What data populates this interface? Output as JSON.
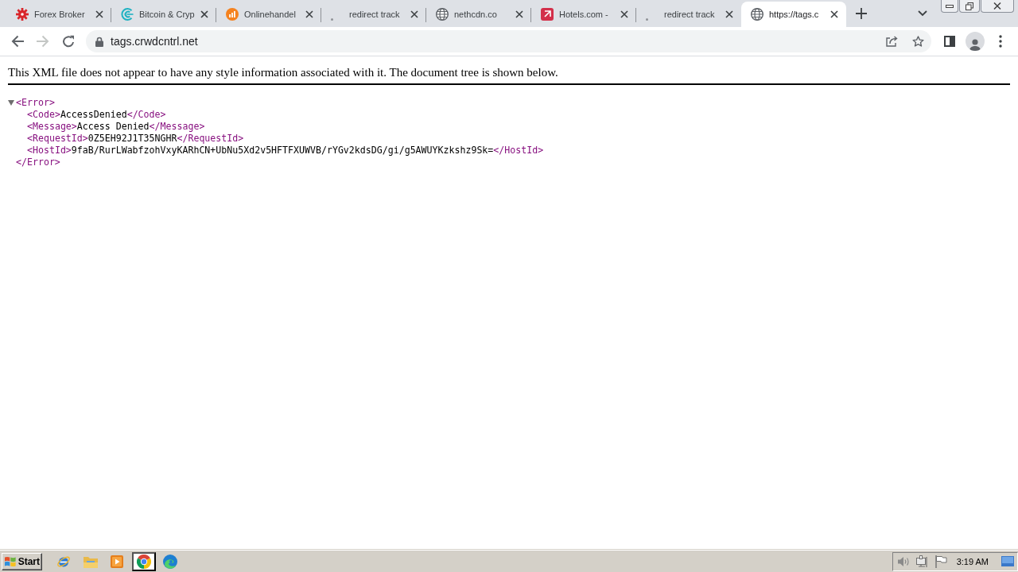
{
  "tabs": [
    {
      "kind": "burst",
      "title": "Forex Broker",
      "selected": false
    },
    {
      "kind": "coin",
      "title": "Bitcoin & Cryp",
      "selected": false
    },
    {
      "kind": "bars",
      "title": "Onlinehandel",
      "selected": false
    },
    {
      "kind": "blank",
      "title": "redirect track",
      "selected": false
    },
    {
      "kind": "globe",
      "title": "nethcdn.co",
      "selected": false
    },
    {
      "kind": "square",
      "title": "Hotels.com -",
      "selected": false
    },
    {
      "kind": "blank",
      "title": "redirect track",
      "selected": false
    },
    {
      "kind": "globe",
      "title": "https://tags.c",
      "selected": true
    }
  ],
  "toolbar": {
    "back": {
      "disabled": false
    },
    "forward": {
      "disabled": true
    },
    "url": "tags.crwdcntrl.net"
  },
  "page": {
    "notice": "This XML file does not appear to have any style information associated with it. The document tree is shown below.",
    "xml": {
      "open": "<Error>",
      "close": "</Error>",
      "expanded": true,
      "children": [
        {
          "open": "<Code>",
          "text": "AccessDenied",
          "close": "</Code>"
        },
        {
          "open": "<Message>",
          "text": "Access Denied",
          "close": "</Message>"
        },
        {
          "open": "<RequestId>",
          "text": "0Z5EH92J1T35NGHR",
          "close": "</RequestId>"
        },
        {
          "open": "<HostId>",
          "text": "9faB/RurLWabfzohVxyKARhCN+UbNu5Xd2v5HFTFXUWVB/rYGv2kdsDG/gi/g5AWUYKzkshz9Sk=",
          "close": "</HostId>"
        }
      ]
    }
  },
  "taskbar": {
    "start": "Start",
    "apps": [
      {
        "kind": "orbit",
        "selected": false
      },
      {
        "kind": "folder",
        "selected": false
      },
      {
        "kind": "player",
        "selected": false
      },
      {
        "kind": "wheel",
        "selected": true
      },
      {
        "kind": "swirl",
        "selected": false
      }
    ],
    "clock": "3:19 AM"
  }
}
